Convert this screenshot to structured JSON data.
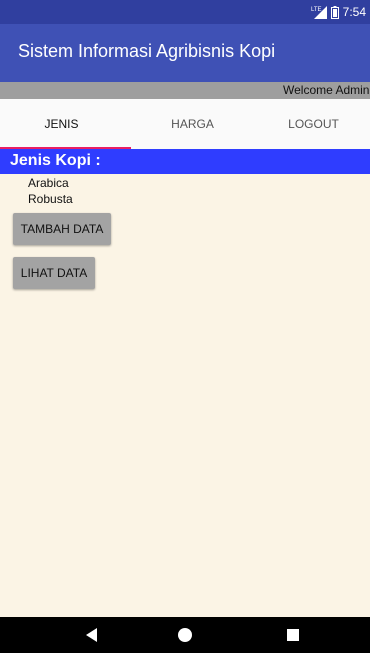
{
  "status_bar": {
    "network_label": "LTE",
    "time": "7:54",
    "icons": [
      "signal-icon",
      "battery-icon"
    ],
    "background": "#303f9f"
  },
  "app_bar": {
    "title": "Sistem Informasi Agribisnis Kopi",
    "background": "#3f51b5"
  },
  "welcome": {
    "text": "Welcome Admin",
    "background": "#9e9e9e"
  },
  "tabs": [
    {
      "label": "JENIS",
      "selected": true
    },
    {
      "label": "HARGA",
      "selected": false
    },
    {
      "label": "LOGOUT",
      "selected": false
    }
  ],
  "tab_indicator_color": "#e91e63",
  "section": {
    "title": "Jenis Kopi :",
    "background": "#2f3dff"
  },
  "coffee_types": [
    {
      "name": "Arabica"
    },
    {
      "name": "Robusta"
    }
  ],
  "buttons": {
    "tambah_label": "TAMBAH DATA",
    "lihat_label": "LIHAT DATA"
  },
  "content_background": "#fbf4e5",
  "nav_bar": {
    "icons": [
      "back-icon",
      "home-icon",
      "recents-icon"
    ]
  }
}
